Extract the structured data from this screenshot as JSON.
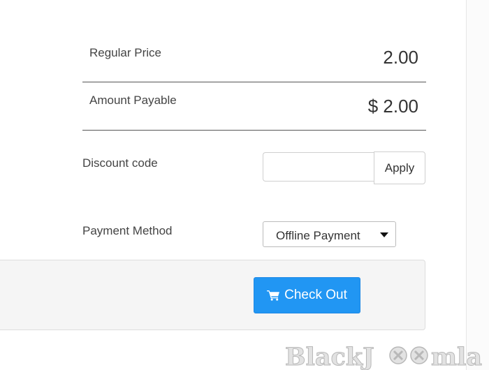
{
  "summary": {
    "regular_price_label": "Regular Price",
    "regular_price_value": "2.00",
    "amount_payable_label": "Amount Payable",
    "amount_payable_value": "$ 2.00"
  },
  "discount": {
    "label": "Discount code",
    "input_value": "",
    "placeholder": "",
    "apply_label": "Apply"
  },
  "payment": {
    "label": "Payment Method",
    "selected": "Offline Payment",
    "icon": "caret-down-icon"
  },
  "checkout": {
    "button_label": "Check Out",
    "icon": "shopping-cart-icon",
    "button_color": "#2196f3"
  },
  "watermark": {
    "text_before": "BlackJ",
    "text_after": "mla"
  }
}
